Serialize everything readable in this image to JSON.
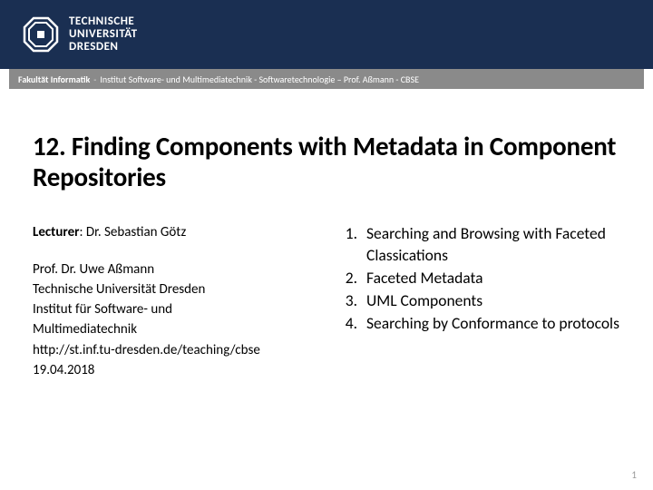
{
  "header": {
    "logo_line1": "TECHNISCHE",
    "logo_line2": "UNIVERSITÄT",
    "logo_line3": "DRESDEN"
  },
  "breadcrumb": {
    "faculty": "Fakultät Informatik",
    "rest": "Institut Software- und Multimediatechnik  -  Softwaretechnologie – Prof. Aßmann  -  CBSE"
  },
  "title": "12. Finding Components with Metadata in Component Repositories",
  "left": {
    "lecturer_label": "Lecturer",
    "lecturer_name": ": Dr. Sebastian Götz",
    "prof": "Prof. Dr. Uwe Aßmann",
    "uni": "Technische Universität Dresden",
    "inst1": "Institut für Software- und",
    "inst2": "Multimediatechnik",
    "url": "http://st.inf.tu-dresden.de/teaching/cbse",
    "date": "19.04.2018"
  },
  "topics": [
    "Searching and Browsing with Faceted Classications",
    "Faceted Metadata",
    "UML Components",
    "Searching by Conformance to protocols"
  ],
  "page_number": "1"
}
